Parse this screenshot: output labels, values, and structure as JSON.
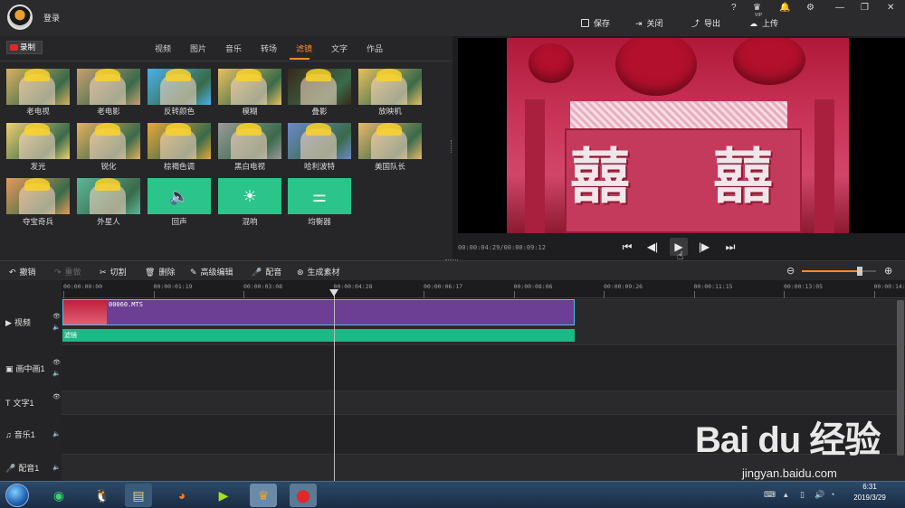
{
  "app": {
    "login": "登录"
  },
  "window_controls": [
    "?",
    "♛",
    "🔔",
    "⚙",
    "—",
    "❐",
    "✕"
  ],
  "vip_label": "VIP",
  "top_actions": [
    {
      "label": "保存",
      "icon": "save-icon"
    },
    {
      "label": "关闭",
      "icon": "exit-icon"
    },
    {
      "label": "导出",
      "icon": "export-icon"
    },
    {
      "label": "上传",
      "icon": "upload-icon"
    }
  ],
  "record_label": "录制",
  "categories": [
    "视频",
    "图片",
    "音乐",
    "转场",
    "滤镜",
    "文字",
    "作品"
  ],
  "active_category": "滤镜",
  "filters": [
    {
      "label": "老电视",
      "tint": "#d8b060"
    },
    {
      "label": "老电影",
      "tint": "#c8a070"
    },
    {
      "label": "反转颜色",
      "tint": "#4ab0e8"
    },
    {
      "label": "模糊",
      "tint": "#e8c060"
    },
    {
      "label": "叠影",
      "tint": "#3a2a1a"
    },
    {
      "label": "放映机",
      "tint": "#e8c060"
    },
    {
      "label": "发光",
      "tint": "#f0d070"
    },
    {
      "label": "锐化",
      "tint": "#e8b060"
    },
    {
      "label": "棕褐色调",
      "tint": "#e8a838"
    },
    {
      "label": "黑白电视",
      "tint": "#9a9a9a"
    },
    {
      "label": "哈利波特",
      "tint": "#6a8ac8"
    },
    {
      "label": "美国队长",
      "tint": "#e8b868"
    },
    {
      "label": "夺宝奇兵",
      "tint": "#e89a58"
    },
    {
      "label": "外星人",
      "tint": "#5ab898"
    },
    {
      "label": "回声",
      "tint": "#2bc48a"
    },
    {
      "label": "混响",
      "tint": "#2bc48a"
    },
    {
      "label": "均衡器",
      "tint": "#2bc48a"
    }
  ],
  "preview": {
    "timecode": "00:00:04:29/00:00:09:12",
    "chars": [
      "囍",
      "囍"
    ]
  },
  "toolbar": [
    {
      "label": "撤销",
      "enabled": true,
      "icon": "undo-icon"
    },
    {
      "label": "重做",
      "enabled": false,
      "icon": "redo-icon"
    },
    {
      "label": "切割",
      "enabled": true,
      "icon": "scissors-icon"
    },
    {
      "label": "删除",
      "enabled": true,
      "icon": "trash-icon"
    },
    {
      "label": "高级编辑",
      "enabled": true,
      "icon": "pencil-icon"
    },
    {
      "label": "配音",
      "enabled": true,
      "icon": "microphone-icon"
    },
    {
      "label": "生成素材",
      "enabled": true,
      "icon": "reel-icon"
    }
  ],
  "zoom": {
    "level": 0.78
  },
  "ruler_ticks": [
    "00:00:00:00",
    "00:00:01:19",
    "00:00:03:08",
    "00:00:04:28",
    "00:00:06:17",
    "00:00:08:06",
    "00:00:09:26",
    "00:00:11:15",
    "00:00:13:05",
    "00:00:14:"
  ],
  "tracks": [
    {
      "label": "视频"
    },
    {
      "label": "画中画1"
    },
    {
      "label": "文字1"
    },
    {
      "label": "音乐1"
    },
    {
      "label": "配音1"
    }
  ],
  "clip": {
    "name": "00060.MTS",
    "filter_label": "滤镜"
  },
  "taskbar": {
    "time": "6:31",
    "date": "2019/3/29"
  },
  "watermark": {
    "brand": "Bai du 经验",
    "url": "jingyan.baidu.com"
  }
}
